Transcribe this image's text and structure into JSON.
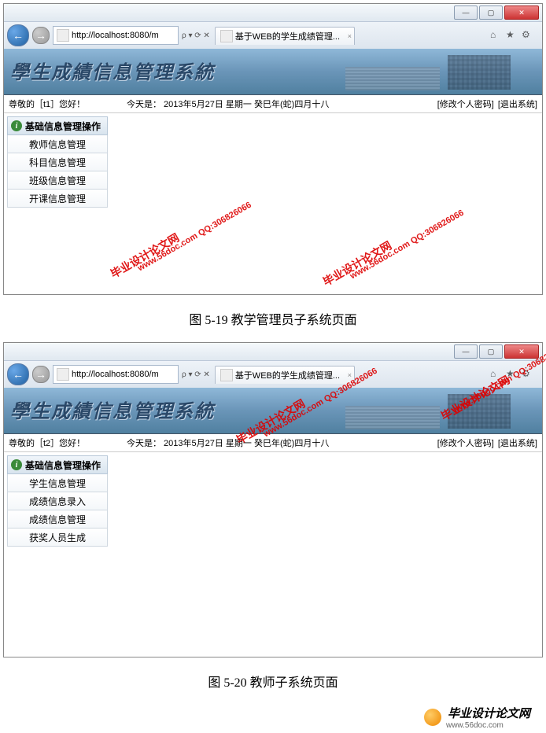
{
  "screenshot1": {
    "window": {
      "min": "—",
      "max": "▢",
      "close": "✕"
    },
    "nav": {
      "back": "←",
      "fwd": "→",
      "url": "http://localhost:8080/m",
      "search_hint": "ρ ▾ ⟳ ✕",
      "refresh": "⟳"
    },
    "tab": {
      "label": "基于WEB的学生成绩管理...",
      "close": "×"
    },
    "toolbar": {
      "home": "⌂",
      "fav": "★",
      "gear": "⚙"
    },
    "app_title": "學生成績信息管理系統",
    "infobar": {
      "greet": "尊敬的［t1］您好！",
      "date": "今天是： 2013年5月27日 星期一 癸巳年(蛇)四月十八",
      "pwd": "[修改个人密码]",
      "logout": "[退出系统]"
    },
    "panel": {
      "title": "基础信息管理操作",
      "icon": "i"
    },
    "menu": [
      "教师信息管理",
      "科目信息管理",
      "班级信息管理",
      "开课信息管理"
    ]
  },
  "caption1": "图 5-19   教学管理员子系统页面",
  "screenshot2": {
    "window": {
      "min": "—",
      "max": "▢",
      "close": "✕"
    },
    "nav": {
      "back": "←",
      "fwd": "→",
      "url": "http://localhost:8080/m",
      "search_hint": "ρ ▾ ⟳ ✕"
    },
    "tab": {
      "label": "基于WEB的学生成绩管理...",
      "close": "×"
    },
    "toolbar": {
      "home": "⌂",
      "fav": "★",
      "gear": "⚙"
    },
    "app_title": "學生成績信息管理系統",
    "infobar": {
      "greet": "尊敬的［t2］您好！",
      "date": "今天是： 2013年5月27日 星期一 癸巳年(蛇)四月十八",
      "pwd": "[修改个人密码]",
      "logout": "[退出系统]"
    },
    "panel": {
      "title": "基础信息管理操作",
      "icon": "i"
    },
    "menu": [
      "学生信息管理",
      "成绩信息录入",
      "成绩信息管理",
      "获奖人员生成"
    ]
  },
  "caption2": "图 5-20   教师子系统页面",
  "watermarks": {
    "main": "毕业设计论文网",
    "url": "www.56doc.com  QQ:306826066"
  },
  "footer": {
    "text": "毕业设计论文网",
    "url": "www.56doc.com"
  }
}
